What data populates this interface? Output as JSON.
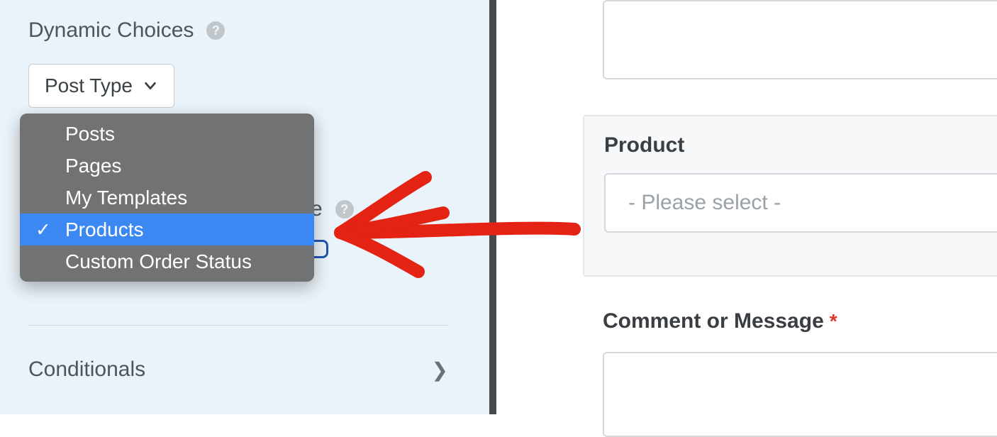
{
  "settings": {
    "dynamic_choices": {
      "label": "Dynamic Choices",
      "select_value": "Post Type",
      "options": [
        {
          "label": "Posts",
          "selected": false
        },
        {
          "label": "Pages",
          "selected": false
        },
        {
          "label": "My Templates",
          "selected": false
        },
        {
          "label": "Products",
          "selected": true
        },
        {
          "label": "Custom Order Status",
          "selected": false
        }
      ],
      "post_type_partial_visible": "e"
    },
    "conditionals": {
      "label": "Conditionals"
    }
  },
  "preview": {
    "product": {
      "label": "Product",
      "placeholder": "- Please select -"
    },
    "comment": {
      "label": "Comment or Message",
      "required": true
    }
  },
  "colors": {
    "panel_bg": "#eaf3fa",
    "dropdown_bg": "#707274",
    "selected_bg": "#3b88f3",
    "arrow": "#e42314"
  }
}
